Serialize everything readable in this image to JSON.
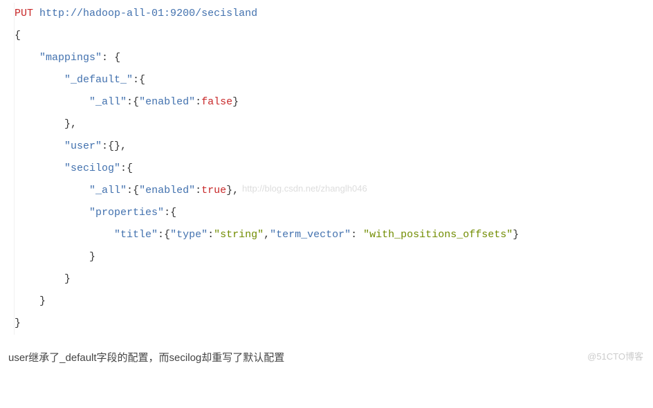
{
  "code": {
    "method": "PUT",
    "url": "http://hadoop-all-01:9200/secisland",
    "braces": {
      "open": "{",
      "close": "}",
      "close_comma": "},"
    },
    "keys": {
      "mappings": "\"mappings\"",
      "default": "\"_default_\"",
      "all": "\"_all\"",
      "enabled": "\"enabled\"",
      "user": "\"user\"",
      "secilog": "\"secilog\"",
      "properties": "\"properties\"",
      "title": "\"title\"",
      "type": "\"type\"",
      "term_vector": "\"term_vector\""
    },
    "values": {
      "false": "false",
      "true": "true",
      "string": "\"string\"",
      "with_positions_offsets": "\"with_positions_offsets\""
    },
    "punct": {
      "colon": ":",
      "colon_open": ":{",
      "empty_obj_comma": ":{},",
      "comma": ",",
      "colon_space": ": "
    }
  },
  "watermark1": "http://blog.csdn.net/zhanglh046",
  "description": "user继承了_default字段的配置，而secilog却重写了默认配置",
  "watermark2": "@51CTO博客"
}
